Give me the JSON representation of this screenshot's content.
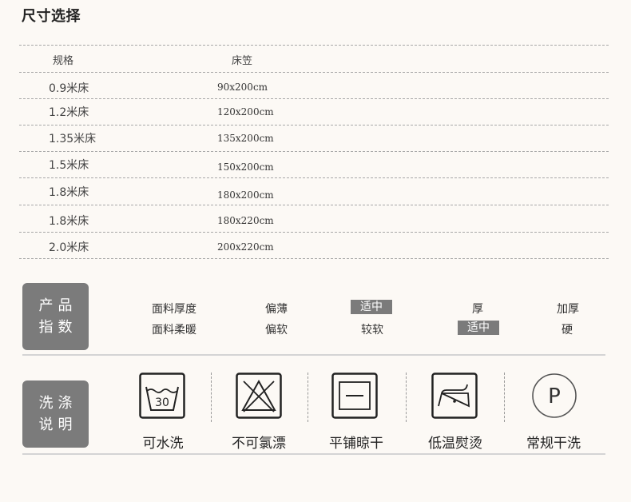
{
  "size_section": {
    "title": "尺寸选择",
    "headers": {
      "spec": "规格",
      "sheet": "床笠"
    },
    "rows": [
      {
        "spec": "0.9米床",
        "sheet": "90x200cm"
      },
      {
        "spec": "1.2米床",
        "sheet": "120x200cm"
      },
      {
        "spec": "1.35米床",
        "sheet": "135x200cm"
      },
      {
        "spec": "1.5米床",
        "sheet": "150x200cm"
      },
      {
        "spec": "1.8米床",
        "sheet": "180x200cm"
      },
      {
        "spec": "1.8米床",
        "sheet": "180x220cm"
      },
      {
        "spec": "2.0米床",
        "sheet": "200x220cm"
      }
    ]
  },
  "product_index": {
    "badge_line1": "产品",
    "badge_line2": "指数",
    "rows": [
      {
        "label": "面料厚度",
        "options": [
          "偏薄",
          "适中",
          "厚",
          "加厚"
        ],
        "selected": "适中"
      },
      {
        "label": "面料柔暖",
        "options": [
          "偏软",
          "较软",
          "适中",
          "硬"
        ],
        "selected": "适中"
      }
    ]
  },
  "care": {
    "badge_line1": "洗涤",
    "badge_line2": "说明",
    "items": [
      {
        "icon": "washtub-30-icon",
        "label": "可水洗",
        "text": "30"
      },
      {
        "icon": "no-bleach-icon",
        "label": "不可氯漂"
      },
      {
        "icon": "dry-flat-icon",
        "label": "平铺晾干"
      },
      {
        "icon": "iron-low-icon",
        "label": "低温熨烫"
      },
      {
        "icon": "dry-clean-p-icon",
        "label": "常规干洗",
        "text": "P"
      }
    ]
  }
}
